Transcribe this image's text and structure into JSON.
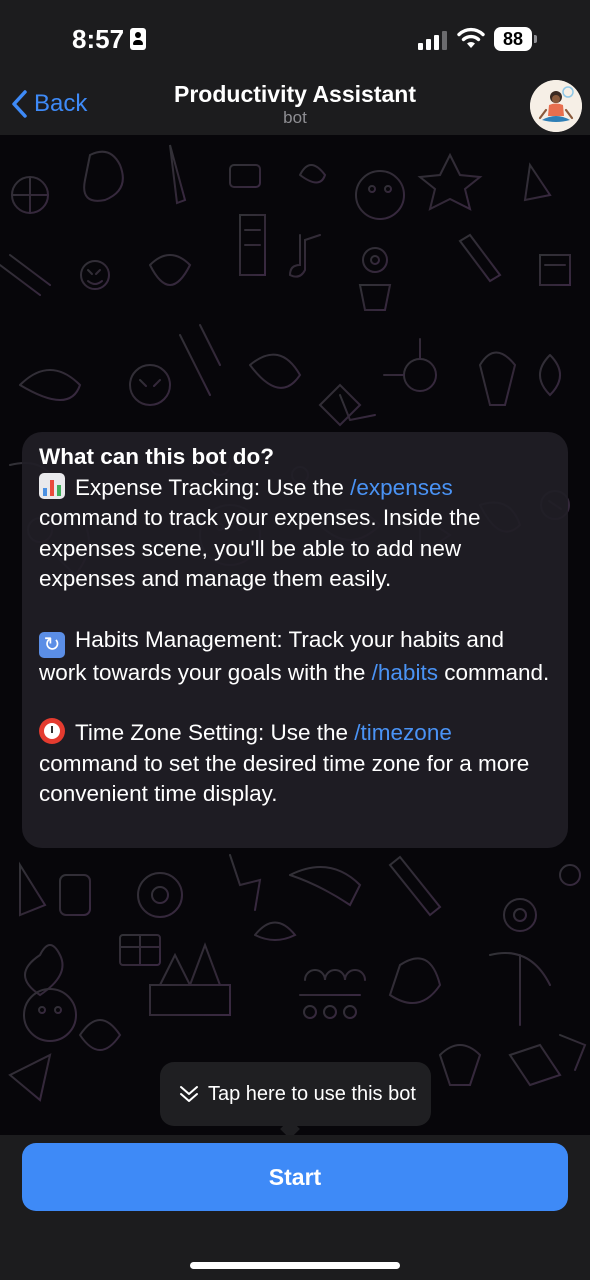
{
  "status_bar": {
    "time": "8:57",
    "battery": "88"
  },
  "header": {
    "back_label": "Back",
    "title": "Productivity Assistant",
    "subtitle": "bot"
  },
  "card": {
    "title": "What can this bot do?",
    "items": [
      {
        "emoji": "bar-chart-emoji",
        "lead": "Expense Tracking: Use the ",
        "command": "/expenses",
        "rest": " command to track your expenses. Inside the expenses scene, you'll be able to add new expenses and manage them easily."
      },
      {
        "emoji": "arrows-cycle-emoji",
        "lead": "Habits Management: Track your habits and work towards your goals with the ",
        "command": "/habits",
        "rest": " command."
      },
      {
        "emoji": "alarm-clock-emoji",
        "lead": "Time Zone Setting: Use the ",
        "command": "/timezone",
        "rest": " command to set the desired time zone for a more convenient time display."
      }
    ]
  },
  "tooltip": {
    "text": "Tap here to use this bot"
  },
  "start_button": {
    "label": "Start"
  },
  "colors": {
    "accent": "#3e8af7",
    "link": "#4a93f5",
    "bar": "#1c1c1e",
    "card": "#201e26"
  }
}
